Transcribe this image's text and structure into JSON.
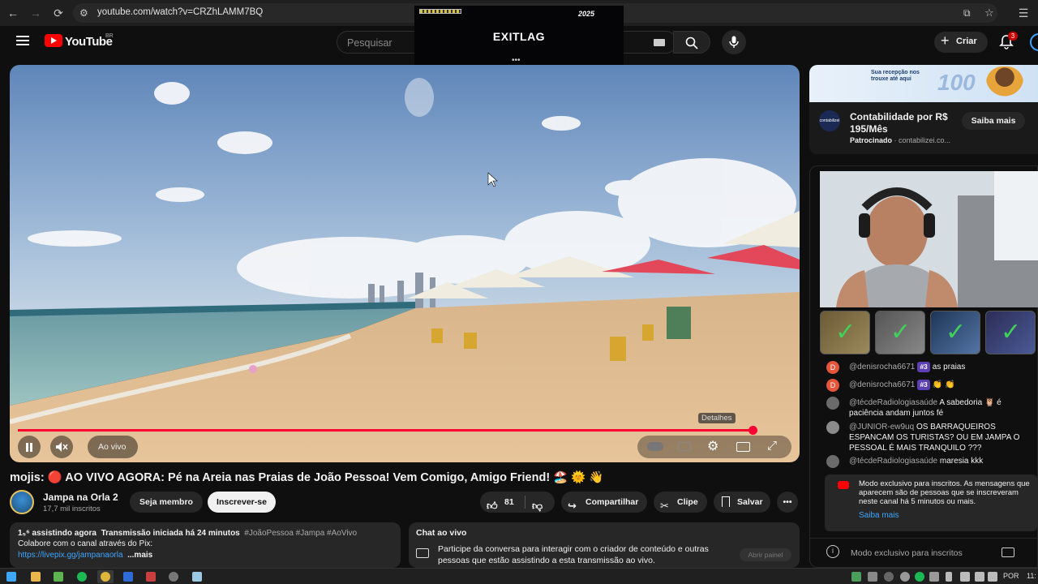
{
  "browser": {
    "url": "youtube.com/watch?v=CRZhLAMM7BQ"
  },
  "header": {
    "logo_text": "YouTube",
    "country_code": "BR",
    "search_placeholder": "Pesquisar",
    "create_label": "Criar",
    "notification_count": "3"
  },
  "overlay": {
    "brand": "EXITLAG",
    "year": "2025",
    "menu_dots": "•••"
  },
  "player": {
    "status_label": "Ao vivo",
    "details_label": "Detalhes",
    "progress_fraction": 0.95
  },
  "video": {
    "title": "mojis: 🔴 AO VIVO AGORA: Pé na Areia nas Praias de João Pessoa! Vem Comigo, Amigo Friend! 🏖️ 🌞 👋",
    "channel_name": "Jampa na Orla 2",
    "subscribers": "17,7 mil inscritos",
    "member_label": "Seja membro",
    "subscribe_label": "Inscrever-se",
    "like_count": "81",
    "share_label": "Compartilhar",
    "clip_label": "Clipe",
    "save_label": "Salvar"
  },
  "description": {
    "watching": "1₅⁶ assistindo agora",
    "started": "Transmissão iniciada há 24 minutos",
    "hashtags": "#JoãoPessoa #Jampa #AoVivo",
    "line2": "Colabore com o canal através do Pix:",
    "link": "https://livepix.gg/jampanaorla",
    "more": "...mais"
  },
  "livechat_bottom": {
    "title": "Chat ao vivo",
    "text": "Participe da conversa para interagir com o criador de conteúdo e outras pessoas que estão assistindo a esta transmissão ao vivo.",
    "open_panel": "Abrir painel"
  },
  "ad": {
    "banner_text": "Sua recepção nos trouxe até aqui",
    "banner_number": "100",
    "logo_text": "contabilizei",
    "title": "Contabilidade por R$ 195/Mês",
    "sponsored": "Patrocinado",
    "domain": "contabilizei.co...",
    "cta": "Saiba mais"
  },
  "chat": {
    "messages": [
      {
        "initial": "D",
        "color": "#e5543b",
        "author": "@denisrocha6671",
        "badge": "#3",
        "text": "as praias"
      },
      {
        "initial": "D",
        "color": "#e5543b",
        "author": "@denisrocha6671",
        "badge": "#3",
        "text": "👏 👏"
      },
      {
        "initial": "",
        "color": "#6b6b6b",
        "author": "@técdeRadiologiasaúde",
        "badge": "",
        "text": "A sabedoria 🦉 é paciência andam juntos fé"
      },
      {
        "initial": "",
        "color": "#8a8a8a",
        "author": "@JUNIOR-ew9uq",
        "badge": "",
        "text": "OS BARRAQUEIROS ESPANCAM OS TURISTAS? OU EM JAMPA O PESSOAL É MAIS TRANQUILO ???"
      },
      {
        "initial": "",
        "color": "#6b6b6b",
        "author": "@técdeRadiologiasaúde",
        "badge": "",
        "text": "maresia kkk"
      }
    ],
    "members_notice": "Modo exclusivo para inscritos. As mensagens que aparecem são de pessoas que se inscreveram neste canal há 5 minutos ou mais.",
    "members_link": "Saiba mais",
    "footer": "Modo exclusivo para inscritos"
  },
  "taskbar": {
    "lang": "POR",
    "time": "11:"
  },
  "colors": {
    "accent_red": "#ff0033",
    "link_blue": "#3ea6ff",
    "background": "#0f0f0f"
  }
}
